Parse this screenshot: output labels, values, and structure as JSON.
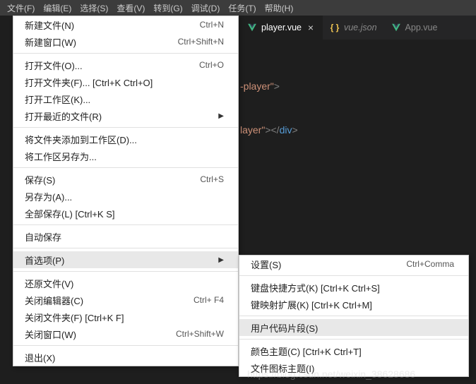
{
  "menubar": [
    "文件(F)",
    "编辑(E)",
    "选择(S)",
    "查看(V)",
    "转到(G)",
    "调试(D)",
    "任务(T)",
    "帮助(H)"
  ],
  "tabs": [
    {
      "label": "player.vue",
      "icon": "vue",
      "active": true,
      "closeable": true
    },
    {
      "label": "vue.json",
      "icon": "json",
      "active": false,
      "closeable": false,
      "italic": true
    },
    {
      "label": "App.vue",
      "icon": "vue",
      "active": false,
      "closeable": false
    }
  ],
  "editor": {
    "line1_str": "-player\"",
    "line1_end": ">",
    "line2_str": "layer\"",
    "line2_mid": "></",
    "line2_tag": "div",
    "line2_end": ">"
  },
  "fileMenu": [
    {
      "label": "新建文件(N)",
      "shortcut": "Ctrl+N"
    },
    {
      "label": "新建窗口(W)",
      "shortcut": "Ctrl+Shift+N"
    },
    {
      "sep": true
    },
    {
      "label": "打开文件(O)...",
      "shortcut": "Ctrl+O"
    },
    {
      "label": "打开文件夹(F)... [Ctrl+K Ctrl+O]",
      "shortcut": ""
    },
    {
      "label": "打开工作区(K)...",
      "shortcut": ""
    },
    {
      "label": "打开最近的文件(R)",
      "shortcut": "",
      "arrow": true
    },
    {
      "sep": true
    },
    {
      "label": "将文件夹添加到工作区(D)...",
      "shortcut": ""
    },
    {
      "label": "将工作区另存为...",
      "shortcut": ""
    },
    {
      "sep": true
    },
    {
      "label": "保存(S)",
      "shortcut": "Ctrl+S"
    },
    {
      "label": "另存为(A)...",
      "shortcut": ""
    },
    {
      "label": "全部保存(L) [Ctrl+K S]",
      "shortcut": ""
    },
    {
      "sep": true
    },
    {
      "label": "自动保存",
      "shortcut": ""
    },
    {
      "sep": true
    },
    {
      "label": "首选项(P)",
      "shortcut": "",
      "arrow": true,
      "hover": true
    },
    {
      "sep": true
    },
    {
      "label": "还原文件(V)",
      "shortcut": ""
    },
    {
      "label": "关闭编辑器(C)",
      "shortcut": "Ctrl+  F4"
    },
    {
      "label": "关闭文件夹(F) [Ctrl+K F]",
      "shortcut": ""
    },
    {
      "label": "关闭窗口(W)",
      "shortcut": "Ctrl+Shift+W"
    },
    {
      "sep": true
    },
    {
      "label": "退出(X)",
      "shortcut": ""
    }
  ],
  "prefMenu": [
    {
      "label": "设置(S)",
      "shortcut": "Ctrl+Comma"
    },
    {
      "sep": true
    },
    {
      "label": "键盘快捷方式(K) [Ctrl+K Ctrl+S]",
      "shortcut": ""
    },
    {
      "label": "键映射扩展(K) [Ctrl+K Ctrl+M]",
      "shortcut": ""
    },
    {
      "sep": true
    },
    {
      "label": "用户代码片段(S)",
      "shortcut": "",
      "hover": true
    },
    {
      "sep": true
    },
    {
      "label": "颜色主题(C) [Ctrl+K Ctrl+T]",
      "shortcut": ""
    },
    {
      "label": "文件图标主题(I)",
      "shortcut": ""
    }
  ],
  "watermark": "https://blog.csdn.net/weixin_38628686"
}
